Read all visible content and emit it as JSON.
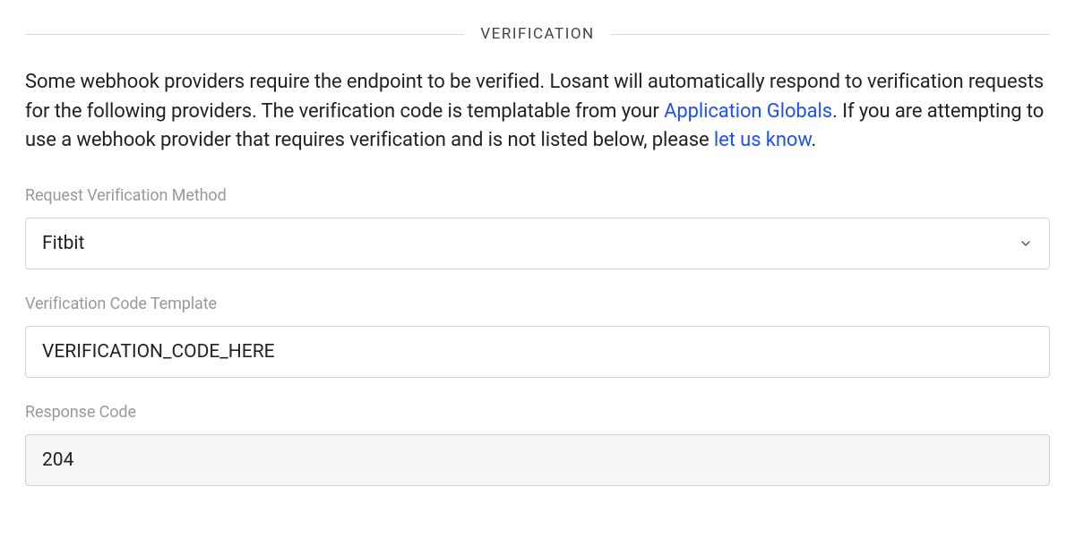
{
  "section": {
    "title": "VERIFICATION",
    "desc_part1": "Some webhook providers require the endpoint to be verified. Losant will automatically respond to verification requests for the following providers. The verification code is templatable from your ",
    "link1": "Application Globals",
    "desc_part2": ". If you are attempting to use a webhook provider that requires verification and is not listed below, please ",
    "link2": "let us know",
    "desc_part3": "."
  },
  "fields": {
    "method": {
      "label": "Request Verification Method",
      "value": "Fitbit"
    },
    "code_template": {
      "label": "Verification Code Template",
      "value": "VERIFICATION_CODE_HERE"
    },
    "response_code": {
      "label": "Response Code",
      "value": "204"
    }
  }
}
